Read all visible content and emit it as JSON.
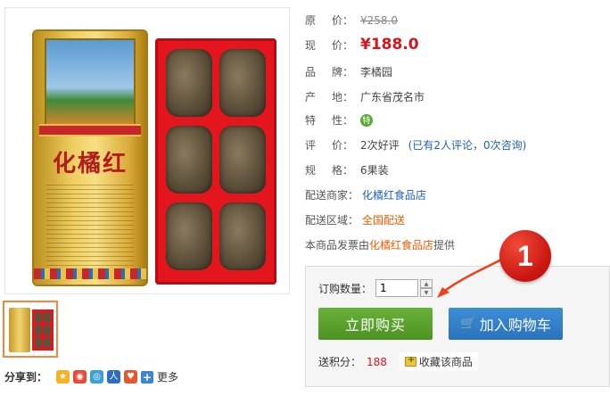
{
  "product": {
    "tin_title": "化橘红"
  },
  "info": {
    "original_price_label": [
      "原",
      "价："
    ],
    "original_price": "¥258.0",
    "current_price_label": [
      "现",
      "价："
    ],
    "current_price": "¥188.0",
    "brand_label": [
      "品",
      "牌："
    ],
    "brand": "李橘园",
    "origin_label": [
      "产",
      "地："
    ],
    "origin": "广东省茂名市",
    "feature_label": [
      "特",
      "性："
    ],
    "feature_icon": "特",
    "review_label": [
      "评",
      "价："
    ],
    "review_text": "2次好评",
    "review_detail": "(已有2人评论，0次咨询)",
    "spec_label": [
      "规",
      "格："
    ],
    "spec": "6果装",
    "merchant_label": "配送商家：",
    "merchant": "化橘红食品店",
    "region_label": "配送区域：",
    "region": "全国配送",
    "invoice_prefix": "本商品发票由",
    "invoice_store": "化橘红食品店",
    "invoice_suffix": "提供"
  },
  "buybox": {
    "qty_label": "订购数量：",
    "qty_value": "1",
    "buy_now": "立即购买",
    "add_to_cart": "加入购物车",
    "points_label": "送积分：",
    "points_value": "188",
    "favorite": "收藏该商品"
  },
  "share": {
    "label": "分享到：",
    "more": "更多"
  },
  "annotation": {
    "number": "1",
    "color": "#d81e14"
  }
}
